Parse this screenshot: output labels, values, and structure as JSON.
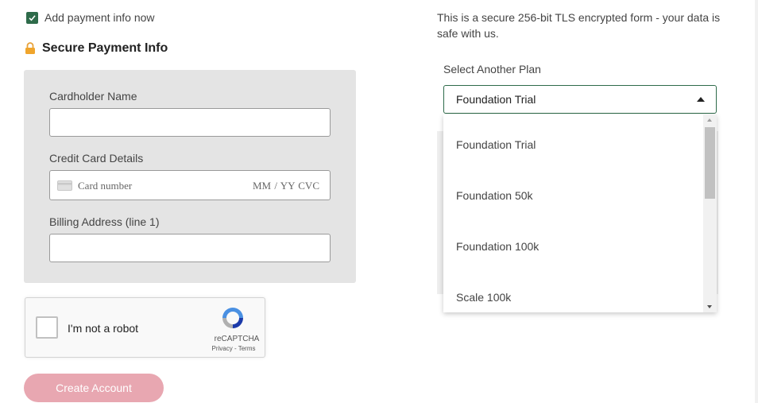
{
  "payment": {
    "add_now_label": "Add payment info now",
    "add_now_checked": true,
    "section_title": "Secure Payment Info",
    "cardholder_label": "Cardholder Name",
    "cardholder_value": "",
    "card_details_label": "Credit Card Details",
    "card_number_placeholder": "Card number",
    "card_expiry_cvc_placeholder": "MM / YY  CVC",
    "billing_label": "Billing Address (line 1)",
    "billing_value": ""
  },
  "captcha": {
    "label": "I'm not a robot",
    "brand": "reCAPTCHA",
    "links": "Privacy - Terms",
    "checked": false
  },
  "create_button_label": "Create Account",
  "security_note": "This is a secure 256-bit TLS encrypted form - your data is safe with us.",
  "plan": {
    "label": "Select Another Plan",
    "selected": "Foundation Trial",
    "options": [
      "Foundation Trial",
      "Foundation 50k",
      "Foundation 100k",
      "Scale 100k"
    ]
  },
  "colors": {
    "accent_green": "#2e6b4a",
    "button_pink": "#e8a7b1",
    "panel_gray": "#e4e4e4"
  },
  "icons": {
    "checkbox": "check-icon",
    "lock": "lock-icon",
    "card": "credit-card-icon",
    "captcha": "recaptcha-logo-icon",
    "caret": "caret-up-icon"
  }
}
